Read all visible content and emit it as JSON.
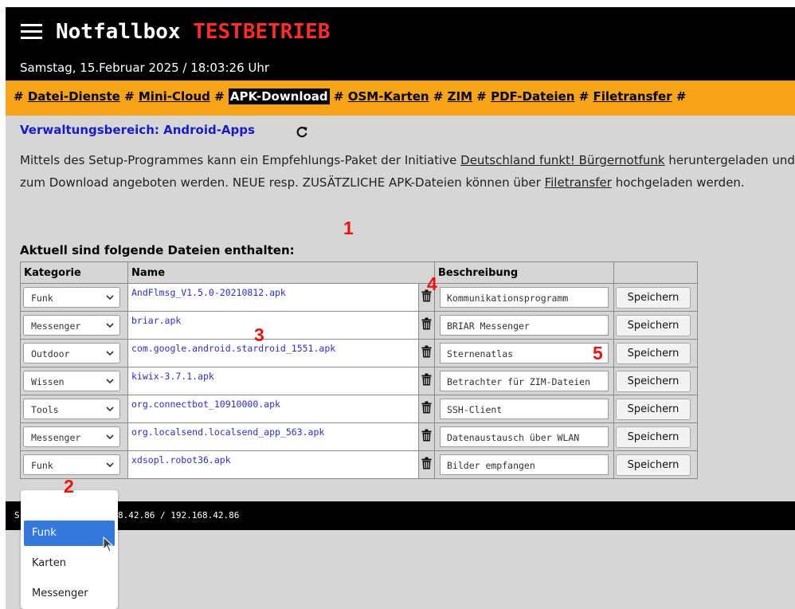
{
  "header": {
    "app_name": "Notfallbox",
    "mode_badge": "TESTBETRIEB",
    "datetime": "Samstag, 15.Februar 2025 / 18:03:26 Uhr",
    "menu_icon": "hamburger-icon"
  },
  "nav": {
    "items": [
      {
        "label": "Datei-Dienste"
      },
      {
        "label": "Mini-Cloud"
      },
      {
        "label": "APK-Download"
      },
      {
        "label": "OSM-Karten"
      },
      {
        "label": "ZIM"
      },
      {
        "label": "PDF-Dateien"
      },
      {
        "label": "Filetransfer"
      }
    ],
    "separator": "#",
    "active": "APK-Download"
  },
  "section": {
    "heading": "Verwaltungsbereich: Android-Apps",
    "reload_icon": "reload-icon",
    "desc_part1": "Mittels des Setup-Programmes kann ein Empfehlungs-Paket der Initiative ",
    "desc_link1": "Deutschland funkt! Bürgernotfunk",
    "desc_part2": " heruntergeladen und dem Nutzer zum Download angeboten werden. NEUE resp. ZUSÄTZLICHE APK-Dateien können über ",
    "desc_link2": "Filetransfer",
    "desc_part3": " hochgeladen werden."
  },
  "table": {
    "heading": "Aktuell sind folgende Dateien enthalten:",
    "columns": {
      "category": "Kategorie",
      "name": "Name",
      "description": "Beschreibung"
    },
    "save_label": "Speichern",
    "delete_icon": "trash-icon",
    "rows": [
      {
        "category": "Funk",
        "name": "AndFlmsg_V1.5.0-20210812.apk",
        "description": "Kommunikationsprogramm"
      },
      {
        "category": "Messenger",
        "name": "briar.apk",
        "description": "BRIAR Messenger"
      },
      {
        "category": "Outdoor",
        "name": "com.google.android.stardroid_1551.apk",
        "description": "Sternenatlas"
      },
      {
        "category": "Wissen",
        "name": "kiwix-3.7.1.apk",
        "description": "Betrachter für ZIM-Dateien"
      },
      {
        "category": "Tools",
        "name": "org.connectbot_10910000.apk",
        "description": "SSH-Client"
      },
      {
        "category": "Messenger",
        "name": "org.localsend.localsend_app_563.apk",
        "description": "Datenaustausch über WLAN"
      },
      {
        "category": "Funk",
        "name": "xdsopl.robot36.apk",
        "description": "Bilder empfangen"
      }
    ]
  },
  "footer": {
    "text": "8.42.86 / 192.168.42.86",
    "prefix": "S"
  },
  "dropdown": {
    "options": [
      "Funk",
      "Karten",
      "Messenger"
    ],
    "selected": "Funk"
  },
  "annotations": [
    "1",
    "2",
    "3",
    "4",
    "5"
  ],
  "colors": {
    "header_bg": "#000000",
    "nav_bg": "#f7a418",
    "accent_red": "#ff2a2a",
    "link_blue": "#1a1acc",
    "selected_option": "#3478dc"
  }
}
